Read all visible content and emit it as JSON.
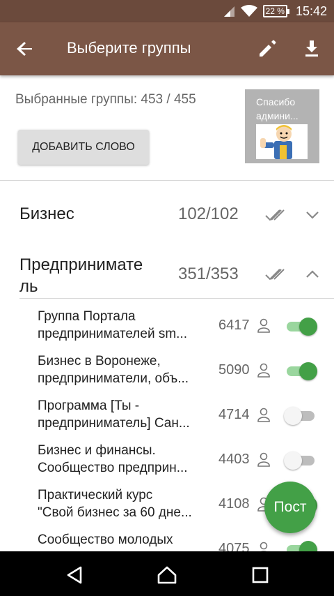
{
  "status_bar": {
    "battery": "22 %",
    "time": "15:42"
  },
  "app_bar": {
    "title": "Выберите группы",
    "back_icon": "arrow-back-icon",
    "edit_icon": "pencil-icon",
    "download_icon": "download-icon"
  },
  "summary": {
    "selected_text": "Выбранные группы: 453 / 455"
  },
  "add_word_button": "ДОБАВИТЬ СЛОВО",
  "ad": {
    "line1": "Спасибо",
    "line2": "админи..."
  },
  "categories": [
    {
      "name": "Бизнес",
      "count": "102/102",
      "expanded": false
    },
    {
      "name_line1": "Предпринимате",
      "name_line2": "ль",
      "count": "351/353",
      "expanded": true
    }
  ],
  "groups": [
    {
      "line1": "Группа Портала",
      "line2": "предпринимателей sm...",
      "count": "6417",
      "enabled": true
    },
    {
      "line1": "Бизнес в  Воронеже,",
      "line2": "предприниматели, объ...",
      "count": "5090",
      "enabled": true
    },
    {
      "line1": "Программа [Ты -",
      "line2": "предприниматель] Сан...",
      "count": "4714",
      "enabled": false
    },
    {
      "line1": "Бизнес и финансы.",
      "line2": "Сообщество предприн...",
      "count": "4403",
      "enabled": false
    },
    {
      "line1": "Практический курс",
      "line2": "\"Свой бизнес за 60 дне...",
      "count": "4108",
      "enabled": true
    },
    {
      "line1": "Сообщество молодых",
      "line2": "",
      "count": "4075",
      "enabled": true
    }
  ],
  "fab_label": "Пост",
  "colors": {
    "primary": "#7b5646",
    "status": "#6b4a3c",
    "accent": "#43a047"
  }
}
